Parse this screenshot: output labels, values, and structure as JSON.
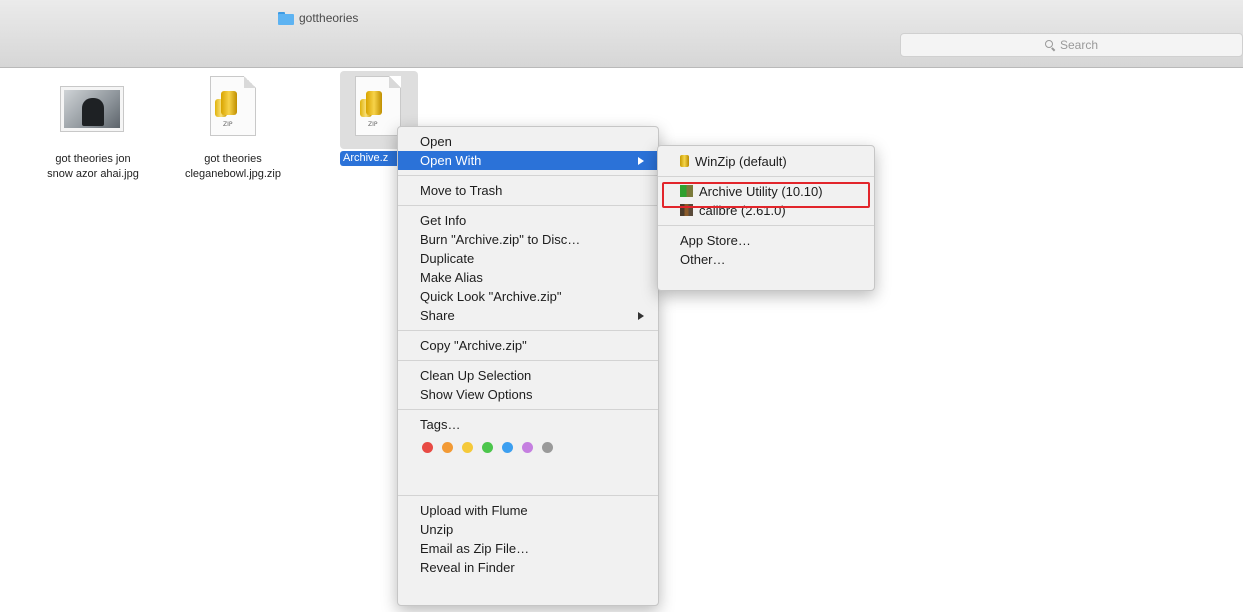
{
  "window": {
    "title": "gottheories"
  },
  "toolbar": {
    "search_placeholder": "Search"
  },
  "files": [
    {
      "name": "got theories jon\nsnow azor ahai.jpg",
      "kind": "image"
    },
    {
      "name": "got theories\ncleganebowl.jpg.zip",
      "kind": "zip",
      "badge": "ZIP"
    },
    {
      "name": "Archive.zip",
      "kind": "zip",
      "badge": "ZIP",
      "selected": true,
      "visible_label": "Archive.z"
    }
  ],
  "context_menu": {
    "open": "Open",
    "open_with": "Open With",
    "move_to_trash": "Move to Trash",
    "get_info": "Get Info",
    "burn": "Burn \"Archive.zip\" to Disc…",
    "duplicate": "Duplicate",
    "make_alias": "Make Alias",
    "quick_look": "Quick Look \"Archive.zip\"",
    "share": "Share",
    "copy": "Copy \"Archive.zip\"",
    "clean_up": "Clean Up Selection",
    "show_view_options": "Show View Options",
    "tags": "Tags…",
    "tag_colors": [
      "#e84a44",
      "#f29a35",
      "#f5c93a",
      "#4cc64c",
      "#3c9ff0",
      "#c57fe0",
      "#9a9a9a"
    ],
    "upload_flume": "Upload with Flume",
    "unzip": "Unzip",
    "email_zip": "Email as Zip File…",
    "reveal": "Reveal in Finder"
  },
  "open_with_submenu": {
    "winzip": "WinZip (default)",
    "archive_utility": "Archive Utility (10.10)",
    "calibre": "calibre (2.61.0)",
    "app_store": "App Store…",
    "other": "Other…"
  },
  "colors": {
    "selection": "#2b72d8",
    "annotation": "#e2252b"
  }
}
